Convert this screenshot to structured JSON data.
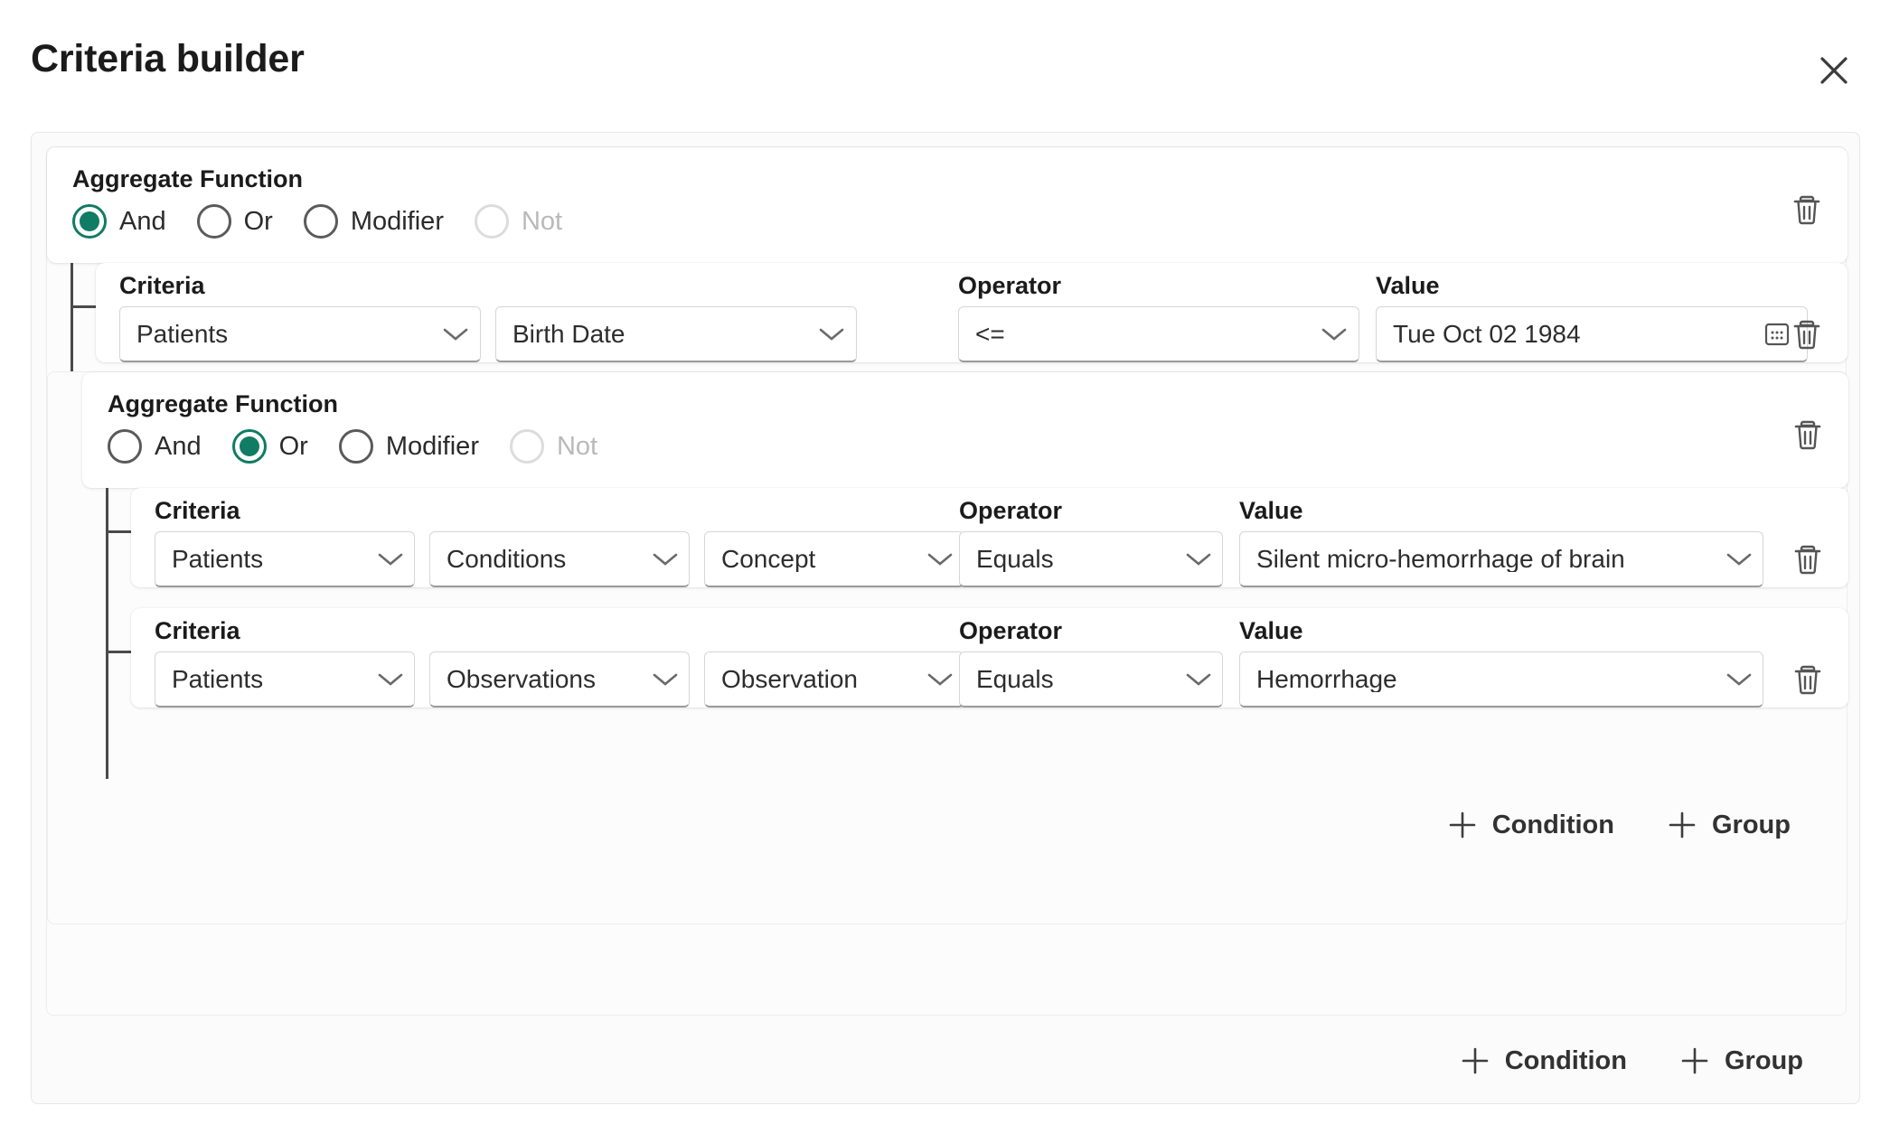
{
  "dialog": {
    "title": "Criteria builder",
    "close_icon": "close-icon"
  },
  "labels": {
    "aggregate_function": "Aggregate Function",
    "criteria": "Criteria",
    "operator": "Operator",
    "value": "Value",
    "delete_icon": "trash-icon",
    "calendar_icon": "calendar-icon",
    "chevron_icon": "chevron-down-icon",
    "plus_icon": "plus-icon"
  },
  "colors": {
    "accent": "#0f7c63",
    "panel_bg": "#fbfbfb",
    "card_bg": "#ffffff",
    "border": "#d6d6d6",
    "disabled_text": "#b9b9b9",
    "connector": "#4a4a4a"
  },
  "aggregate_options": [
    {
      "label": "And",
      "value": "and"
    },
    {
      "label": "Or",
      "value": "or"
    },
    {
      "label": "Modifier",
      "value": "modifier"
    },
    {
      "label": "Not",
      "value": "not"
    }
  ],
  "root_group": {
    "aggregate_label": "Aggregate Function",
    "selected": "and",
    "options": [
      {
        "label": "And",
        "checked": true,
        "disabled": false
      },
      {
        "label": "Or",
        "checked": false,
        "disabled": false
      },
      {
        "label": "Modifier",
        "checked": false,
        "disabled": false
      },
      {
        "label": "Not",
        "checked": false,
        "disabled": true
      }
    ]
  },
  "condition_1": {
    "criteria_label": "Criteria",
    "operator_label": "Operator",
    "value_label": "Value",
    "resource": "Patients",
    "field": "Birth Date",
    "operator": "<=",
    "value": "Tue Oct 02 1984"
  },
  "nested_group": {
    "aggregate_label": "Aggregate Function",
    "selected": "or",
    "options": [
      {
        "label": "And",
        "checked": false,
        "disabled": false
      },
      {
        "label": "Or",
        "checked": true,
        "disabled": false
      },
      {
        "label": "Modifier",
        "checked": false,
        "disabled": false
      },
      {
        "label": "Not",
        "checked": false,
        "disabled": true
      }
    ]
  },
  "condition_2": {
    "criteria_label": "Criteria",
    "operator_label": "Operator",
    "value_label": "Value",
    "resource": "Patients",
    "category": "Conditions",
    "field": "Concept",
    "operator": "Equals",
    "value": "Silent micro-hemorrhage of brain"
  },
  "condition_3": {
    "criteria_label": "Criteria",
    "operator_label": "Operator",
    "value_label": "Value",
    "resource": "Patients",
    "category": "Observations",
    "field": "Observation",
    "operator": "Equals",
    "value": "Hemorrhage"
  },
  "nested_actions": {
    "add_condition": "Condition",
    "add_group": "Group"
  },
  "root_actions": {
    "add_condition": "Condition",
    "add_group": "Group"
  }
}
